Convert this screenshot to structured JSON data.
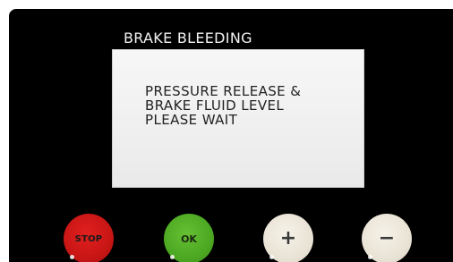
{
  "screen": {
    "title": "BRAKE BLEEDING",
    "message_lines": [
      "PRESSURE RELEASE &",
      "BRAKE FLUID LEVEL",
      "PLEASE WAIT"
    ]
  },
  "buttons": {
    "stop": {
      "label": "STOP",
      "color": "#c81615"
    },
    "ok": {
      "label": "OK",
      "color": "#4ca822"
    },
    "plus": {
      "label": "+",
      "icon": "plus-icon",
      "color": "#e8e2d4"
    },
    "minus": {
      "label": "−",
      "icon": "minus-icon",
      "color": "#e8e2d4"
    }
  }
}
